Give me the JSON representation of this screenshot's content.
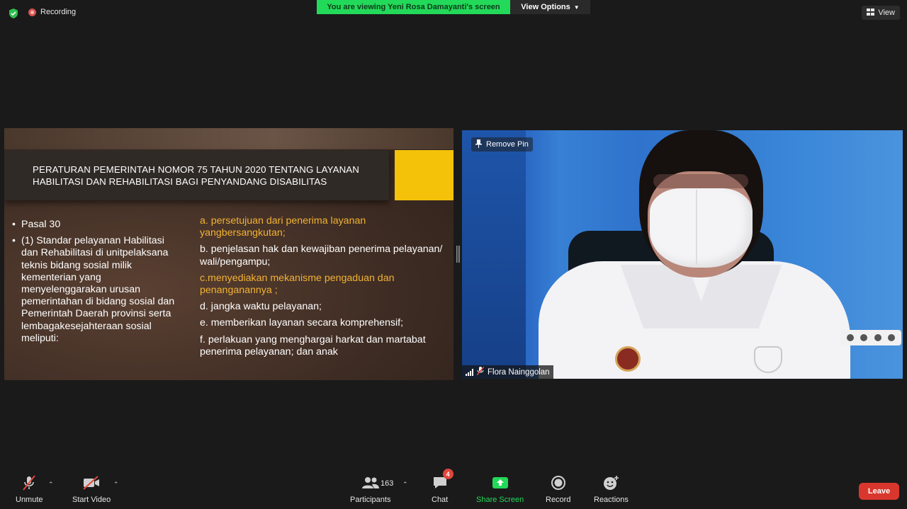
{
  "top_bar": {
    "recording_label": "Recording",
    "viewing_banner": "You are viewing Yeni Rosa Damayanti's screen",
    "view_options_label": "View Options",
    "view_label": "View"
  },
  "slide": {
    "title": "PERATURAN PEMERINTAH  NOMOR 75 TAHUN 2020 TENTANG LAYANAN HABILITASI DAN REHABILITASI BAGI PENYANDANG DISABILITAS",
    "left_bullets": [
      "Pasal 30",
      "(1) Standar pelayanan Habilitasi dan Rehabilitasi di unitpelaksana teknis bidang sosial milik kementerian yang menyelenggarakan urusan pemerintahan di bidang sosial dan Pemerintah Daerah provinsi serta lembagakesejahteraan sosial meliputi:"
    ],
    "right_items": [
      "a. persetujuan dari penerima layanan yangbersangkutan;",
      "b. penjelasan hak dan kewajiban penerima pelayanan/ wali/pengampu;",
      "c.menyediakan mekanisme pengaduan dan penanganannya ;",
      "d. jangka waktu pelayanan;",
      "e. memberikan layanan secara komprehensif;",
      "f. perlakuan yang menghargai harkat dan martabat penerima pelayanan; dan anak"
    ],
    "colors": {
      "accent_yellow": "#f5c20a",
      "highlight_text": "#f2b233"
    }
  },
  "video": {
    "remove_pin_label": "Remove Pin",
    "participant_name": "Flora Nainggolan"
  },
  "toolbar": {
    "unmute_label": "Unmute",
    "start_video_label": "Start Video",
    "participants_label": "Participants",
    "participants_count": "163",
    "chat_label": "Chat",
    "chat_badge": "4",
    "share_screen_label": "Share Screen",
    "record_label": "Record",
    "reactions_label": "Reactions",
    "leave_label": "Leave",
    "colors": {
      "share_green": "#23d959",
      "leave_red": "#d9372e"
    }
  }
}
